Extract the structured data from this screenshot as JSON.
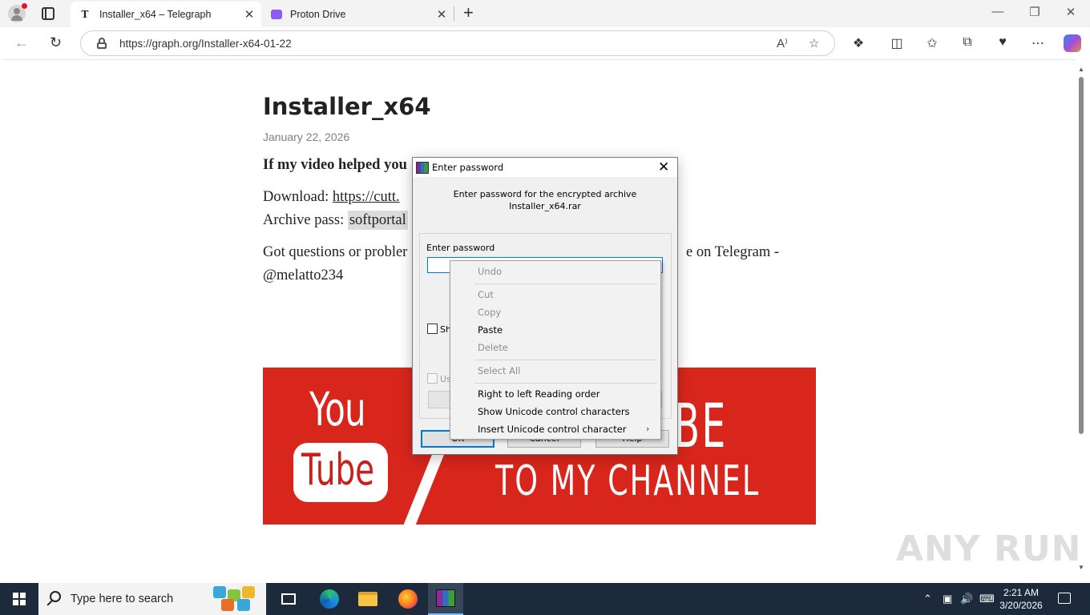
{
  "browser": {
    "tabs": [
      {
        "favicon": "T",
        "title": "Installer_x64 – Telegraph",
        "active": true
      },
      {
        "favicon": "proton-drive-icon",
        "title": "Proton Drive",
        "active": false
      }
    ],
    "url": "https://graph.org/Installer-x64-01-22",
    "new_tab": "+",
    "close_glyph": "✕",
    "window_controls": {
      "minimize": "—",
      "restore": "❐",
      "close": "✕"
    },
    "icons": [
      "profile-icon",
      "tab-actions-icon",
      "back-icon",
      "reload-icon",
      "lock-icon",
      "read-aloud-icon",
      "favorite-icon",
      "extensions-icon",
      "split-screen-icon",
      "favorites-icon",
      "collections-icon",
      "browser-essentials-icon",
      "more-icon",
      "copilot-icon"
    ]
  },
  "article": {
    "title": "Installer_x64",
    "date": "January 22, 2026",
    "line1": "If my video helped you",
    "download_label": "Download: ",
    "download_link": "https://cutt.",
    "archive_label": "Archive pass: ",
    "archive_pass": "softportal",
    "questions_start": "Got questions or probler",
    "questions_end": "e on Telegram -",
    "handle": "@melatto234",
    "banner": {
      "you": "You",
      "tube": "Tube",
      "subscribe": "SUBSCRIBE",
      "channel": "TO MY CHANNEL",
      "bg_color": "#d9261c"
    }
  },
  "watermark": "ANY RUN",
  "dialog": {
    "title": "Enter password",
    "message_line1": "Enter password for the encrypted archive",
    "message_line2": "Installer_x64.rar",
    "field_label": "Enter password",
    "password_value": "",
    "show_password_label": "Sh",
    "use_label": "Us",
    "ok": "OK",
    "cancel": "Cancel",
    "help": "Help"
  },
  "context_menu": {
    "items": [
      {
        "label": "Undo",
        "enabled": false
      },
      {
        "label": "Cut",
        "enabled": false
      },
      {
        "label": "Copy",
        "enabled": false
      },
      {
        "label": "Paste",
        "enabled": true
      },
      {
        "label": "Delete",
        "enabled": false
      },
      {
        "label": "Select All",
        "enabled": false
      },
      {
        "label": "Right to left Reading order",
        "enabled": true
      },
      {
        "label": "Show Unicode control characters",
        "enabled": true
      },
      {
        "label": "Insert Unicode control character",
        "enabled": true
      }
    ],
    "submenu_arrow": "›"
  },
  "taskbar": {
    "search_placeholder": "Type here to search",
    "apps": [
      "task-view-icon",
      "edge-icon",
      "file-explorer-icon",
      "firefox-icon",
      "winrar-icon"
    ],
    "active_app": "winrar-icon",
    "tray_icons": [
      "chevron-up-icon",
      "meet-now-icon",
      "volume-icon",
      "input-language-icon"
    ],
    "time": "2:21 AM",
    "date": "3/20/2026",
    "accent": "#1c2a3c"
  }
}
